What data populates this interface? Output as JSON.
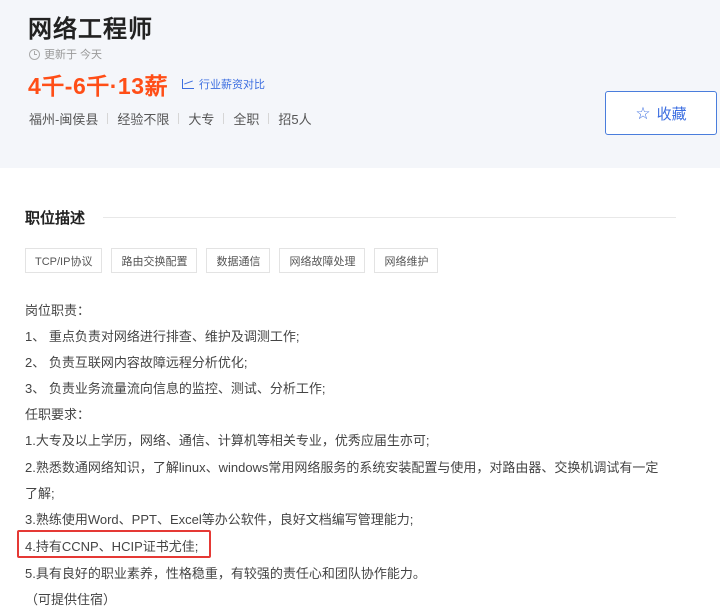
{
  "job": {
    "title": "网络工程师",
    "updated": "更新于 今天",
    "salary": "4千-6千·13薪",
    "compare_label": "行业薪资对比",
    "meta": [
      "福州-闽侯县",
      "经验不限",
      "大专",
      "全职",
      "招5人"
    ]
  },
  "actions": {
    "collect_label": "收藏"
  },
  "description": {
    "section_title": "职位描述",
    "tags": [
      "TCP/IP协议",
      "路由交换配置",
      "数据通信",
      "网络故障处理",
      "网络维护"
    ],
    "lines": [
      "岗位职责：",
      "1、 重点负责对网络进行排查、维护及调测工作;",
      "2、 负责互联网内容故障远程分析优化;",
      "3、 负责业务流量流向信息的监控、测试、分析工作;",
      "任职要求：",
      "1.大专及以上学历，网络、通信、计算机等相关专业，优秀应届生亦可;",
      "2.熟悉数通网络知识，了解linux、windows常用网络服务的系统安装配置与使用，对路由器、交换机调试有一定",
      "了解;",
      "3.熟练使用Word、PPT、Excel等办公软件，良好文档编写管理能力;",
      "4.持有CCNP、HCIP证书尤佳;",
      "5.具有良好的职业素养，性格稳重，有较强的责任心和团队协作能力。",
      "（可提供住宿）"
    ]
  },
  "colors": {
    "salary": "#ff4e17",
    "accent": "#3c6ee0",
    "highlight": "#e53935"
  },
  "icons": {
    "update": "clock-icon",
    "compare": "chart-icon",
    "collect": "star-icon"
  }
}
